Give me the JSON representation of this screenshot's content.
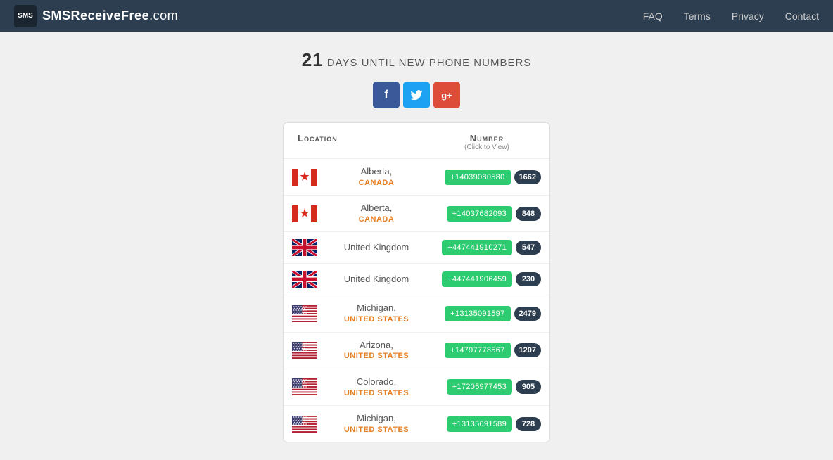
{
  "header": {
    "logo_sms": "SMS",
    "logo_text": "SMSReceiveFree",
    "logo_domain": ".com",
    "nav": {
      "faq": "FAQ",
      "terms": "Terms",
      "privacy": "Privacy",
      "contact": "Contact"
    }
  },
  "countdown": {
    "number": "21",
    "label": "DAYS UNTIL NEW PHONE NUMBERS"
  },
  "social": {
    "facebook": "f",
    "twitter": "t",
    "googleplus": "g+"
  },
  "table": {
    "col_location": "Location",
    "col_number": "Number",
    "col_number_sub": "(Click to View)",
    "rows": [
      {
        "state": "Alberta,",
        "country": "CANADA",
        "flag": "canada",
        "number": "+14039080580",
        "count": "1662"
      },
      {
        "state": "Alberta,",
        "country": "CANADA",
        "flag": "canada",
        "number": "+14037682093",
        "count": "848"
      },
      {
        "state": "United Kingdom",
        "country": "",
        "flag": "uk",
        "number": "+447441910271",
        "count": "547"
      },
      {
        "state": "United Kingdom",
        "country": "",
        "flag": "uk",
        "number": "+447441906459",
        "count": "230"
      },
      {
        "state": "Michigan,",
        "country": "UNITED STATES",
        "flag": "us",
        "number": "+13135091597",
        "count": "2479"
      },
      {
        "state": "Arizona,",
        "country": "UNITED STATES",
        "flag": "us",
        "number": "+14797778567",
        "count": "1207"
      },
      {
        "state": "Colorado,",
        "country": "UNITED STATES",
        "flag": "us",
        "number": "+17205977453",
        "count": "905"
      },
      {
        "state": "Michigan,",
        "country": "UNITED STATES",
        "flag": "us",
        "number": "+13135091589",
        "count": "728"
      }
    ]
  }
}
